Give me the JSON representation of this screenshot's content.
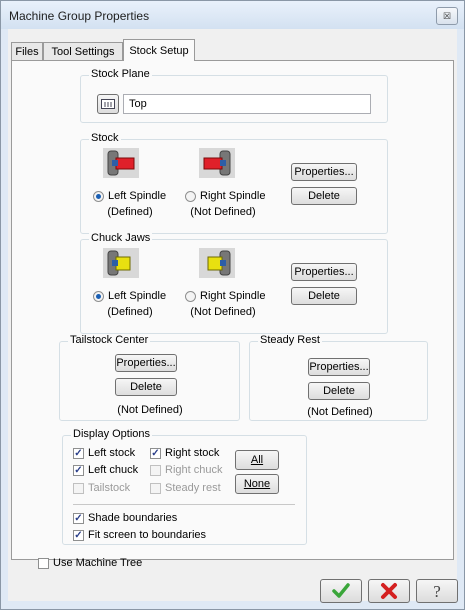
{
  "window": {
    "title": "Machine Group Properties",
    "close_glyph": "☒"
  },
  "tabs": [
    {
      "label": "Files"
    },
    {
      "label": "Tool Settings"
    },
    {
      "label": "Stock Setup"
    }
  ],
  "stock_plane": {
    "legend": "Stock Plane",
    "value": "Top",
    "icon": "plane-selector-icon"
  },
  "stock": {
    "legend": "Stock",
    "left_label": "Left Spindle",
    "left_status": "(Defined)",
    "right_label": "Right Spindle",
    "right_status": "(Not Defined)",
    "properties": "Properties...",
    "delete": "Delete",
    "icon_color": "#e0202a"
  },
  "chuck_jaws": {
    "legend": "Chuck Jaws",
    "left_label": "Left Spindle",
    "left_status": "(Defined)",
    "right_label": "Right Spindle",
    "right_status": "(Not Defined)",
    "properties": "Properties...",
    "delete": "Delete",
    "icon_color": "#e8e010"
  },
  "tailstock": {
    "legend": "Tailstock Center",
    "properties": "Properties...",
    "delete": "Delete",
    "status": "(Not Defined)"
  },
  "steady_rest": {
    "legend": "Steady Rest",
    "properties": "Properties...",
    "delete": "Delete",
    "status": "(Not Defined)"
  },
  "display_options": {
    "legend": "Display Options",
    "left_stock": "Left stock",
    "right_stock": "Right stock",
    "left_chuck": "Left chuck",
    "right_chuck": "Right chuck",
    "tailstock": "Tailstock",
    "steady_rest": "Steady rest",
    "all": "All",
    "none": "None",
    "shade": "Shade boundaries",
    "fit": "Fit screen to boundaries"
  },
  "use_machine_tree": "Use Machine Tree",
  "dialog_buttons": {
    "ok_icon": "checkmark-icon",
    "cancel_icon": "cross-icon",
    "help_icon": "question-icon"
  },
  "colors": {
    "accent": "#1a5fb4",
    "ok": "#3aa63a",
    "cancel": "#d42020"
  }
}
